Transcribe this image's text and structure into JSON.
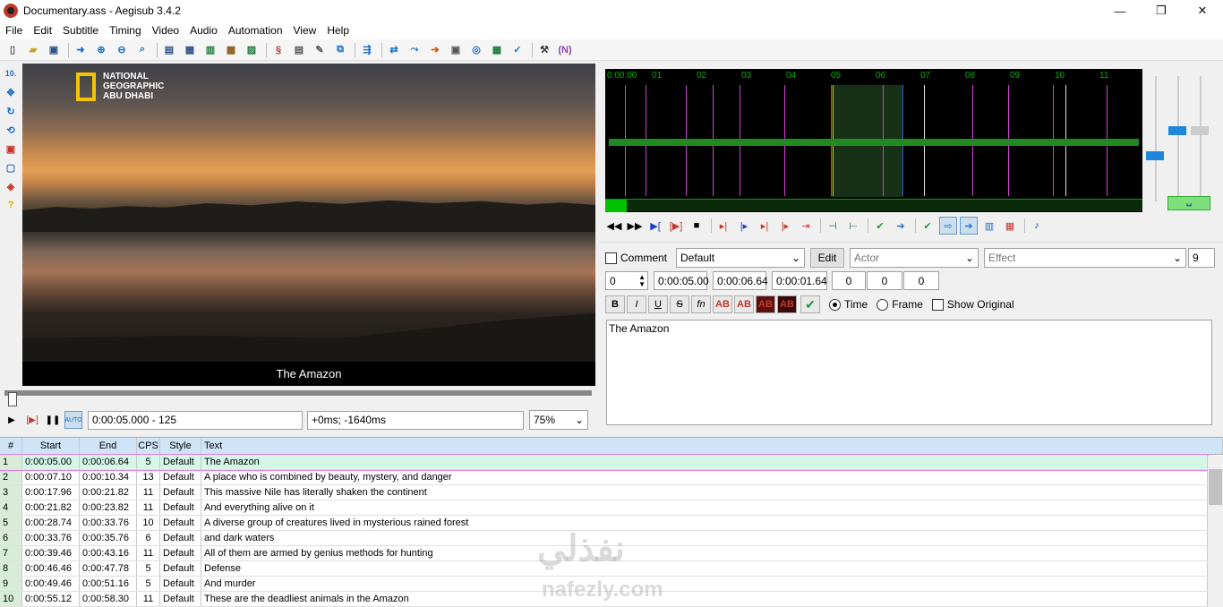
{
  "window": {
    "title": "Documentary.ass - Aegisub 3.4.2",
    "controls": [
      "—",
      "❐",
      "✕"
    ]
  },
  "menu": [
    "File",
    "Edit",
    "Subtitle",
    "Timing",
    "Video",
    "Audio",
    "Automation",
    "View",
    "Help"
  ],
  "video": {
    "logo_line1": "NATIONAL",
    "logo_line2": "GEOGRAPHIC",
    "logo_line3": "ABU DHABI",
    "subtitle": "The Amazon",
    "position": "0:00:05.000 - 125",
    "offset": "+0ms; -1640ms",
    "zoom": "75%"
  },
  "audio": {
    "time_labels": [
      "0:00:00",
      "01",
      "02",
      "03",
      "04",
      "05",
      "06",
      "07",
      "08",
      "09",
      "10",
      "11"
    ],
    "auto_label": "␣"
  },
  "editor": {
    "comment_label": "Comment",
    "style": "Default",
    "edit_label": "Edit",
    "actor_placeholder": "Actor",
    "effect_placeholder": "Effect",
    "char_count": "9",
    "layer": "0",
    "start": "0:00:05.00",
    "end": "0:00:06.64",
    "duration": "0:00:01.64",
    "margin_l": "0",
    "margin_r": "0",
    "margin_v": "0",
    "time_label": "Time",
    "frame_label": "Frame",
    "show_original_label": "Show Original",
    "text": "The Amazon"
  },
  "grid": {
    "headers": [
      "#",
      "Start",
      "End",
      "CPS",
      "Style",
      "Text"
    ],
    "rows": [
      [
        "1",
        "0:00:05.00",
        "0:00:06.64",
        "5",
        "Default",
        "The Amazon"
      ],
      [
        "2",
        "0:00:07.10",
        "0:00:10.34",
        "13",
        "Default",
        "A place who is combined by beauty, mystery, and danger"
      ],
      [
        "3",
        "0:00:17.96",
        "0:00:21.82",
        "11",
        "Default",
        "This massive Nile has literally shaken the continent"
      ],
      [
        "4",
        "0:00:21.82",
        "0:00:23.82",
        "11",
        "Default",
        "And everything alive on it"
      ],
      [
        "5",
        "0:00:28.74",
        "0:00:33.76",
        "10",
        "Default",
        "A diverse group of creatures lived in mysterious rained forest"
      ],
      [
        "6",
        "0:00:33.76",
        "0:00:35.76",
        "6",
        "Default",
        "and dark waters"
      ],
      [
        "7",
        "0:00:39.46",
        "0:00:43.16",
        "11",
        "Default",
        "All of them are armed by genius methods for hunting"
      ],
      [
        "8",
        "0:00:46.46",
        "0:00:47.78",
        "5",
        "Default",
        "Defense"
      ],
      [
        "9",
        "0:00:49.46",
        "0:00:51.16",
        "5",
        "Default",
        "And murder"
      ],
      [
        "10",
        "0:00:55.12",
        "0:00:58.30",
        "11",
        "Default",
        "These are the deadliest animals in the Amazon"
      ]
    ]
  },
  "watermark": {
    "arabic": "نفذلي",
    "latin": "nafezly.com"
  }
}
